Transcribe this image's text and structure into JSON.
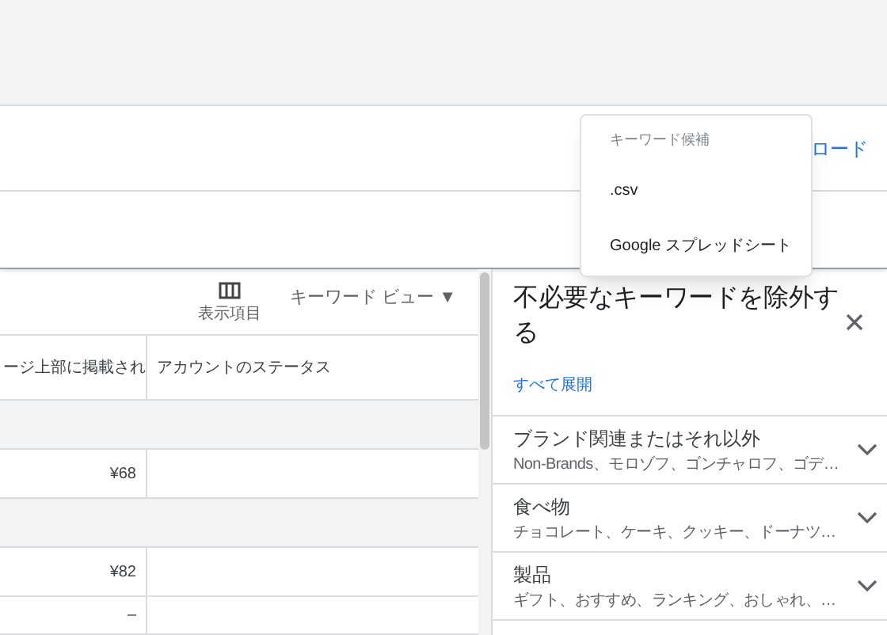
{
  "download_link": "ロード",
  "menu": {
    "header": "キーワード候補",
    "items": [
      {
        "label": ".csv"
      },
      {
        "label": "Google スプレッドシート"
      }
    ]
  },
  "toolbar": {
    "columns_button": "表示項目",
    "view_dropdown": "キーワード ビュー ▼"
  },
  "table": {
    "columns": [
      "ージ上部に掲載され",
      "アカウントのステータス"
    ],
    "rows": [
      {
        "kind": "group",
        "cells": []
      },
      {
        "kind": "data",
        "cells": [
          "¥68",
          ""
        ]
      },
      {
        "kind": "group",
        "cells": []
      },
      {
        "kind": "data",
        "cells": [
          "¥82",
          ""
        ]
      },
      {
        "kind": "data",
        "cells": [
          "–",
          ""
        ]
      }
    ]
  },
  "panel": {
    "title": "不必要なキーワードを除外する",
    "expand_all": "すべて展開",
    "sections": [
      {
        "title": "ブランド関連またはそれ以外",
        "summary": "Non-Brands、モロゾフ、ゴンチャロフ、ゴデ…",
        "expanded": false
      },
      {
        "title": "食べ物",
        "summary": "チョコレート、ケーキ、クッキー、ドーナツ…",
        "expanded": false
      },
      {
        "title": "製品",
        "summary": "ギフト、おすすめ、ランキング、おしゃれ、…",
        "expanded": false
      }
    ]
  }
}
